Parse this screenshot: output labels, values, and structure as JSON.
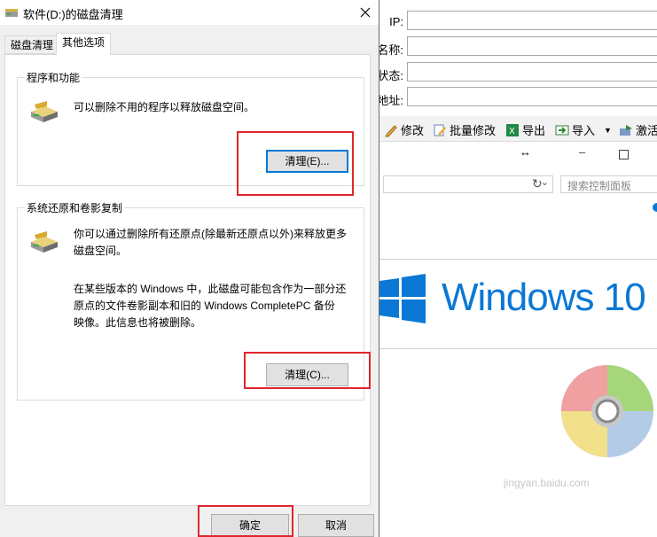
{
  "dialog": {
    "title": "软件(D:)的磁盘清理",
    "tabs": [
      {
        "label": "磁盘清理"
      },
      {
        "label": "其他选项"
      }
    ],
    "programs_group": {
      "title": "程序和功能",
      "text": "可以删除不用的程序以释放磁盘空间。",
      "button": "清理(E)..."
    },
    "restore_group": {
      "title": "系统还原和卷影复制",
      "text1_line1": "你可以通过删除所有还原点(除最新还原点以外)来释放更多",
      "text1_line2": "磁盘空间。",
      "text2_line1": "在某些版本的 Windows 中，此磁盘可能包含作为一部分还",
      "text2_line2": "原点的文件卷影副本和旧的 Windows CompletePC 备份",
      "text2_line3": "映像。此信息也将被删除。",
      "button": "清理(C)..."
    },
    "ok_button": "确定",
    "cancel_button": "取消"
  },
  "background_window": {
    "fields": [
      {
        "label": "IP:"
      },
      {
        "label": "名称:"
      },
      {
        "label": "状态:"
      },
      {
        "label": "地址:"
      }
    ],
    "toolbar": {
      "edit": "修改",
      "batch_edit": "批量修改",
      "export": "导出",
      "import": "导入",
      "activate": "激活"
    },
    "search_placeholder": "搜索控制面板",
    "windows_logo_text": "Windows 10"
  },
  "watermark": "jingyan.baidu.com",
  "colors": {
    "accent": "#0078d7",
    "highlight_box": "#e0262c",
    "windows_blue": "#0a78d4"
  }
}
